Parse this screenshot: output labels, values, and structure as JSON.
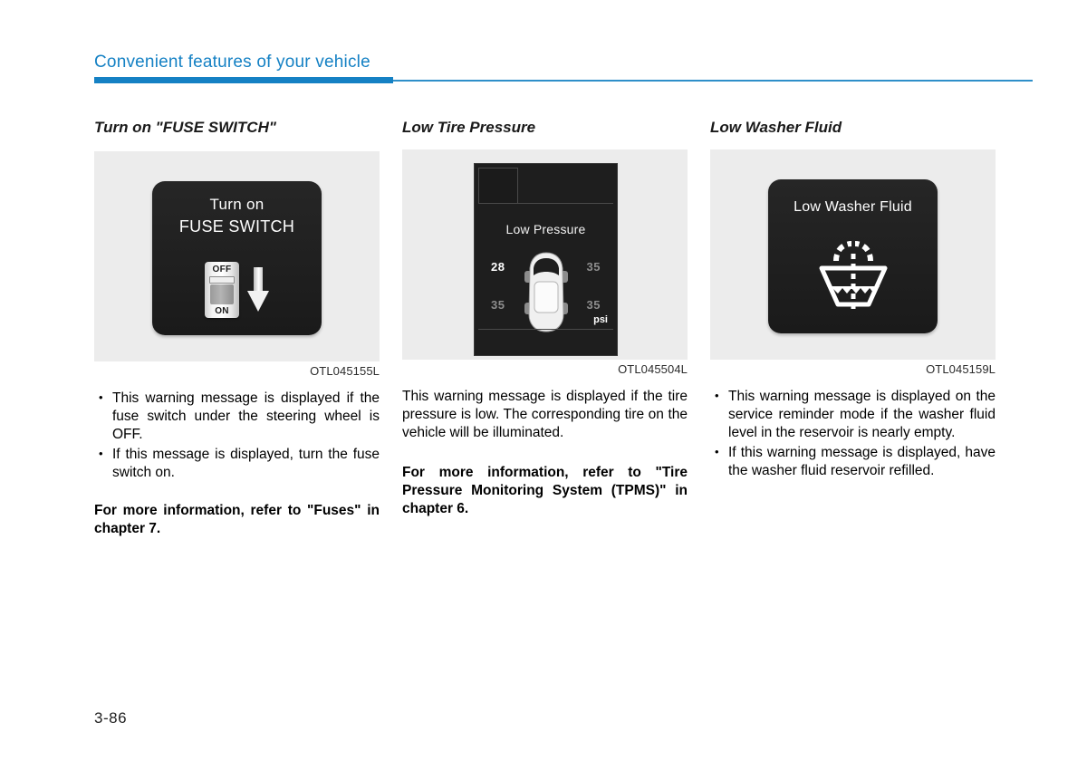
{
  "header": {
    "title": "Convenient features of your vehicle",
    "accent_color": "#1581c4"
  },
  "page_number": "3-86",
  "columns": [
    {
      "heading": "Turn on \"FUSE SWITCH\"",
      "figure": {
        "caption": "OTL045155L",
        "display": {
          "line1": "Turn on",
          "line2": "FUSE SWITCH",
          "switch_top_label": "OFF",
          "switch_bottom_label": "ON",
          "arrow": "down-arrow"
        }
      },
      "bullets": [
        "This warning message is displayed if the fuse switch under the steering wheel is OFF.",
        "If this message is displayed, turn the fuse switch on."
      ],
      "note": "For more information, refer to \"Fuses\" in chapter 7."
    },
    {
      "heading": "Low Tire Pressure",
      "figure": {
        "caption": "OTL045504L",
        "display": {
          "title": "Low Pressure",
          "unit": "psi",
          "tire_values": {
            "front_left": "28",
            "front_right": "35",
            "rear_left": "35",
            "rear_right": "35"
          },
          "alert_position": "front_left"
        }
      },
      "paragraph": "This warning message is displayed if the tire pressure is low. The corresponding tire on the vehicle will be illuminated.",
      "note": "For more information, refer to \"Tire Pressure Monitoring System (TPMS)\" in chapter 6."
    },
    {
      "heading": "Low Washer Fluid",
      "figure": {
        "caption": "OTL045159L",
        "display": {
          "title": "Low Washer Fluid",
          "icon": "windshield-washer-icon"
        }
      },
      "bullets": [
        "This warning message is displayed on the service reminder mode if the washer fluid level in the reservoir is nearly empty.",
        "If this warning message is displayed, have the washer fluid reservoir refilled."
      ]
    }
  ]
}
